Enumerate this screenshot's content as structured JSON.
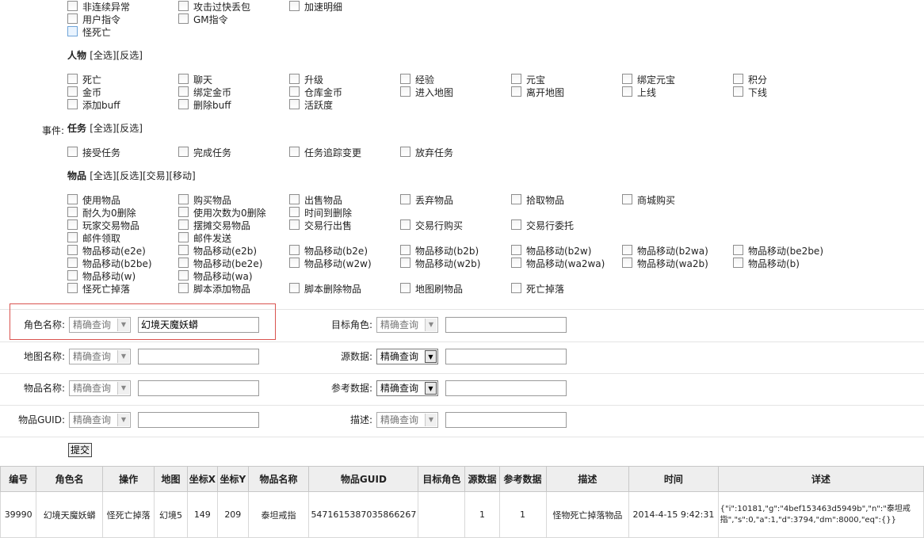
{
  "events_label": "事件:",
  "top_checks": [
    {
      "label": "非连续异常",
      "checked": false
    },
    {
      "label": "攻击过快丢包",
      "checked": false
    },
    {
      "label": "加速明细",
      "checked": false
    },
    {
      "label": "用户指令",
      "checked": false
    },
    {
      "label": "GM指令",
      "checked": false
    },
    {
      "label": "怪死亡",
      "checked": false
    }
  ],
  "sections": [
    {
      "title": "人物",
      "links": [
        "[全选]",
        "[反选]"
      ],
      "items": [
        "死亡",
        "聊天",
        "升级",
        "经验",
        "元宝",
        "绑定元宝",
        "积分",
        "金币",
        "绑定金币",
        "仓库金币",
        "进入地图",
        "离开地图",
        "上线",
        "下线",
        "添加buff",
        "删除buff",
        "活跃度"
      ]
    },
    {
      "title": "任务",
      "links": [
        "[全选]",
        "[反选]"
      ],
      "items": [
        "接受任务",
        "完成任务",
        "任务追踪变更",
        "放弃任务"
      ]
    },
    {
      "title": "物品",
      "links": [
        "[全选]",
        "[反选]",
        "[交易]",
        "[移动]"
      ],
      "items": [
        "使用物品",
        "购买物品",
        "出售物品",
        "丢弃物品",
        "拾取物品",
        "商城购买",
        "耐久为0删除",
        "使用次数为0删除",
        "时间到删除",
        "玩家交易物品",
        "摆摊交易物品",
        "交易行出售",
        "交易行购买",
        "交易行委托",
        "邮件领取",
        "邮件发送",
        "物品移动(e2e)",
        "物品移动(e2b)",
        "物品移动(b2e)",
        "物品移动(b2b)",
        "物品移动(b2w)",
        "物品移动(b2wa)",
        "物品移动(be2be)",
        "物品移动(b2be)",
        "物品移动(be2e)",
        "物品移动(w2w)",
        "物品移动(w2b)",
        "物品移动(wa2wa)",
        "物品移动(wa2b)",
        "物品移动(b)",
        "物品移动(w)",
        "物品移动(wa)",
        "怪死亡掉落",
        "脚本添加物品",
        "脚本删除物品",
        "地图刷物品",
        "死亡掉落"
      ]
    }
  ],
  "form": {
    "role_name_label": "角色名称:",
    "role_name_mode": "精确查询",
    "role_name_value": "幻境天魔妖蟒",
    "target_role_label": "目标角色:",
    "target_role_mode": "精确查询",
    "target_role_value": "",
    "map_name_label": "地图名称:",
    "map_name_mode": "精确查询",
    "map_name_value": "",
    "source_data_label": "源数据:",
    "source_data_mode": "精确查询",
    "source_data_value": "",
    "item_name_label": "物品名称:",
    "item_name_mode": "精确查询",
    "item_name_value": "",
    "ref_data_label": "参考数据:",
    "ref_data_mode": "精确查询",
    "ref_data_value": "",
    "item_guid_label": "物品GUID:",
    "item_guid_mode": "精确查询",
    "item_guid_value": "",
    "desc_label": "描述:",
    "desc_mode": "精确查询",
    "desc_value": "",
    "submit_label": "提交"
  },
  "table": {
    "headers": [
      "编号",
      "角色名",
      "操作",
      "地图",
      "坐标X",
      "坐标Y",
      "物品名称",
      "物品GUID",
      "目标角色",
      "源数据",
      "参考数据",
      "描述",
      "时间",
      "详述"
    ],
    "rows": [
      [
        "39990",
        "幻境天魔妖蟒",
        "怪死亡掉落",
        "幻境5",
        "149",
        "209",
        "泰坦戒指",
        "5471615387035866267",
        "",
        "1",
        "1",
        "怪物死亡掉落物品",
        "2014-4-15 9:42:31",
        "{\"i\":10181,\"g\":\"4bef153463d5949b\",\"n\":\"泰坦戒指\",\"s\":0,\"a\":1,\"d\":3794,\"dm\":8000,\"eq\":{}}"
      ]
    ]
  },
  "colors": {
    "highlight_border": "#d9534f",
    "header_bg": "#eeeeee"
  }
}
